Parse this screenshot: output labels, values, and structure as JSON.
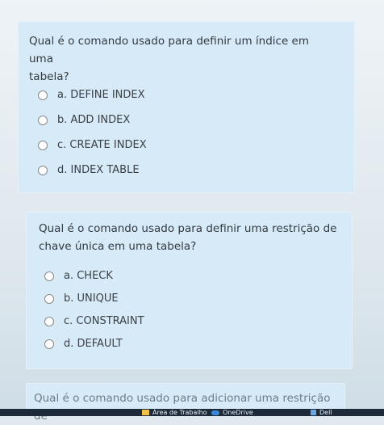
{
  "questions": [
    {
      "text_line1": "Qual é o comando usado para definir um índice em uma",
      "text_line2": "tabela?",
      "options": [
        "a. DEFINE INDEX",
        "b. ADD INDEX",
        "c. CREATE INDEX",
        "d. INDEX TABLE"
      ]
    },
    {
      "text_line1": "Qual é o comando usado para definir uma restrição de",
      "text_line2": "chave única em uma tabela?",
      "options": [
        "a. CHECK",
        "b. UNIQUE",
        "c. CONSTRAINT",
        "d. DEFAULT"
      ]
    },
    {
      "text_line1": "Qual é o comando usado para adicionar uma restrição de"
    }
  ],
  "taskbar": {
    "workspace_label": "Área de Trabalho",
    "onedrive_label": "OneDrive",
    "dell_label": "Dell"
  }
}
